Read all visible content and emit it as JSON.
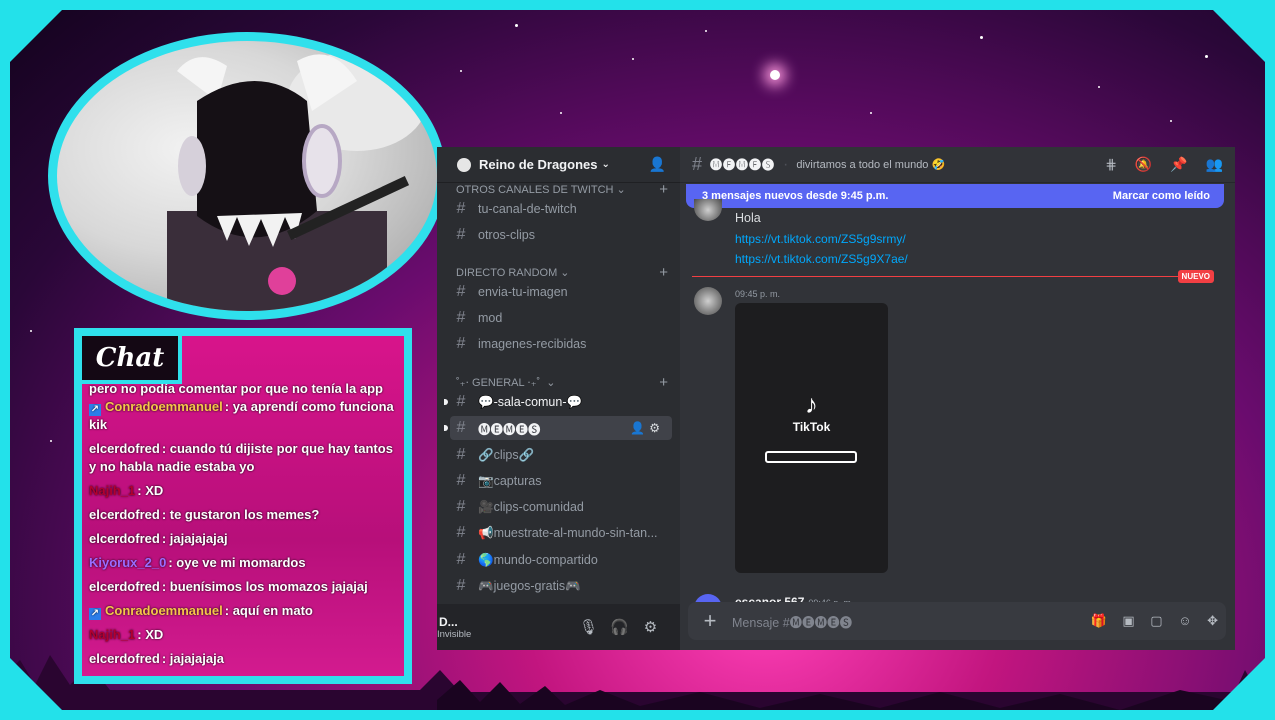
{
  "discord": {
    "server_name": "Reino de Dragones",
    "categories": {
      "twitch": "OTROS CANALES DE TWITCH",
      "random": "DIRECTO RANDOM",
      "general": "˚₊‧ GENERAL ‧₊˚"
    },
    "channels": [
      {
        "name": "tu-canal-de-twitch"
      },
      {
        "name": "otros-clips"
      },
      {
        "name": "envia-tu-imagen"
      },
      {
        "name": "mod"
      },
      {
        "name": "imagenes-recibidas"
      },
      {
        "name": "💬-sala-comun-💬"
      },
      {
        "name": "🅜🅔🅜🅔🅢"
      },
      {
        "name": "🔗clips🔗"
      },
      {
        "name": "📷capturas"
      },
      {
        "name": "🎥clips-comunidad"
      },
      {
        "name": "📢muestrate-al-mundo-sin-tan..."
      },
      {
        "name": "🌎mundo-compartido"
      },
      {
        "name": "🎮juegos-gratis🎮"
      }
    ],
    "user": {
      "name": "D...",
      "status": "Invisible"
    },
    "active_channel": "🅜🅔🅜🅔🅢",
    "topic": "divirtamos a todo el mundo 🤣",
    "new_messages_bar": "3 mensajes nuevos desde 9:45 p.m.",
    "mark_read": "Marcar como leído",
    "messages": {
      "hola": "Hola",
      "link1": "https://vt.tiktok.com/ZS5g9srmy/",
      "link2": "https://vt.tiktok.com/ZS5g9X7ae/",
      "new_tag": "NUEVO",
      "time": "09:45 p. m.",
      "tiktok_label": "TikTok",
      "author": "escanor 567",
      "author_time": "09:46 p. m."
    },
    "input_placeholder": "Mensaje #🅜🅔🅜🅔🅢"
  },
  "chat": {
    "title": "Chat",
    "top_line": "pero no podía comentar por que no tenía la app",
    "lines": [
      {
        "user": "Conradoemmanuel",
        "text": ": ya aprendí como funciona kik",
        "color": "#f5c64a",
        "badge": true
      },
      {
        "user": "elcerdofred",
        "text": ": cuando tú dijiste por que hay tantos y no habla nadie estaba yo",
        "color": "#ffffff"
      },
      {
        "user": "Najih_1",
        "text": ": XD",
        "color": "#b2002f"
      },
      {
        "user": "elcerdofred",
        "text": ": te gustaron los memes?",
        "color": "#ffffff"
      },
      {
        "user": "elcerdofred",
        "text": ": jajajajajaj",
        "color": "#ffffff"
      },
      {
        "user": "Kiyorux_2_0",
        "text": ": oye ve mi momardos",
        "color": "#9b6cff"
      },
      {
        "user": "elcerdofred",
        "text": ": buenísimos los momazos jajajaj",
        "color": "#ffffff"
      },
      {
        "user": "Conradoemmanuel",
        "text": ": aquí en mato",
        "color": "#f5c64a",
        "badge": true
      },
      {
        "user": "Najih_1",
        "text": ": XD",
        "color": "#b2002f"
      },
      {
        "user": "elcerdofred",
        "text": ": jajajajaja",
        "color": "#ffffff"
      }
    ]
  },
  "colors": {
    "accent": "#23e1ea",
    "discord_blurple": "#5865f2",
    "chat_bg": "#c8127f"
  }
}
